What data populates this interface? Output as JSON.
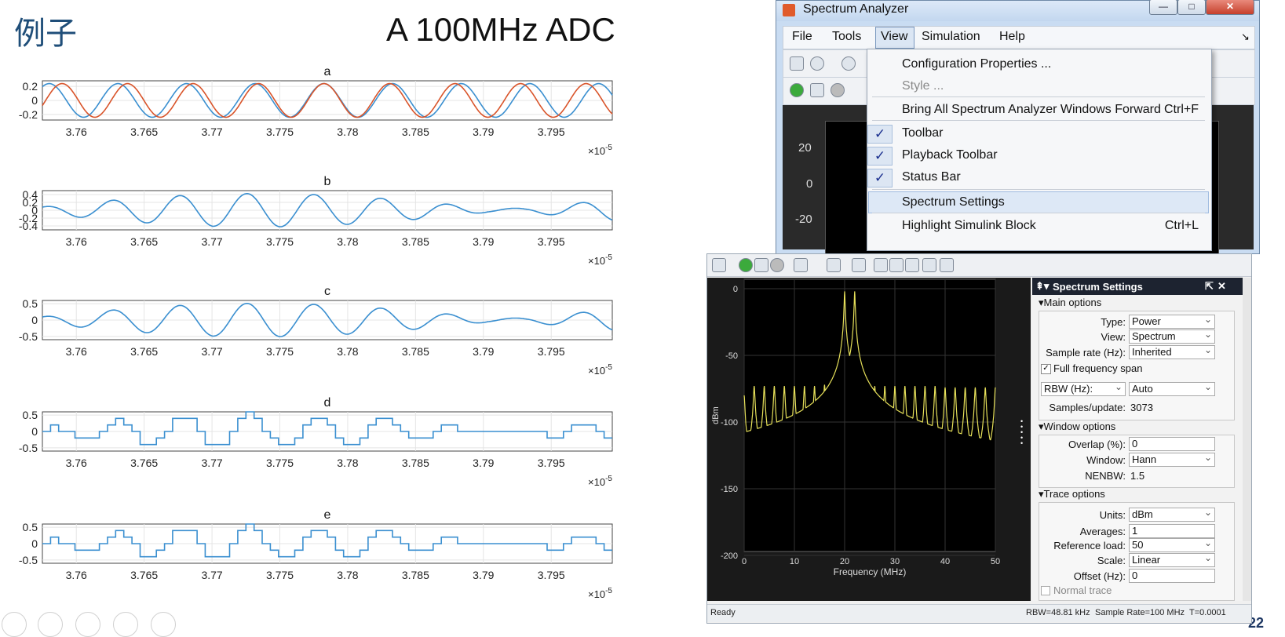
{
  "slide": {
    "title": "例子",
    "heading": "A 100MHz ADC",
    "page_number": "22"
  },
  "plots": [
    {
      "title": "a",
      "yticks": [
        "0.2",
        "0",
        "-0.2"
      ],
      "ylim": [
        -0.28,
        0.28
      ],
      "series_colors": [
        "#3a8fd0",
        "#d9542a"
      ],
      "kind": "two-sines"
    },
    {
      "title": "b",
      "yticks": [
        "0.4",
        "0.2",
        "0",
        "-0.2",
        "-0.4"
      ],
      "ylim": [
        -0.5,
        0.5
      ],
      "series_colors": [
        "#3a8fd0"
      ],
      "kind": "beat"
    },
    {
      "title": "c",
      "yticks": [
        "0.5",
        "0",
        "-0.5"
      ],
      "ylim": [
        -0.6,
        0.6
      ],
      "series_colors": [
        "#3a8fd0"
      ],
      "kind": "beat"
    },
    {
      "title": "d",
      "yticks": [
        "0.5",
        "0",
        "-0.5"
      ],
      "ylim": [
        -0.6,
        0.6
      ],
      "series_colors": [
        "#3a8fd0"
      ],
      "kind": "stairs"
    },
    {
      "title": "e",
      "yticks": [
        "0.5",
        "0",
        "-0.5"
      ],
      "ylim": [
        -0.6,
        0.6
      ],
      "series_colors": [
        "#3a8fd0"
      ],
      "kind": "stairs"
    }
  ],
  "plot_xticks": [
    "3.76",
    "3.765",
    "3.77",
    "3.775",
    "3.78",
    "3.785",
    "3.79",
    "3.795"
  ],
  "plot_xrange": [
    3.7575,
    3.7995
  ],
  "plot_xexp": "×10",
  "plot_xexp_pow": "-5",
  "sa": {
    "title": "Spectrum Analyzer",
    "menu": [
      "File",
      "Tools",
      "View",
      "Simulation",
      "Help"
    ],
    "yticks": [
      "20",
      "0",
      "-20"
    ],
    "view_menu": [
      {
        "label": "Configuration Properties ...",
        "shortcut": "",
        "checked": false,
        "disabled": false
      },
      {
        "label": "Style ...",
        "shortcut": "",
        "checked": false,
        "disabled": true
      },
      {
        "label": "Bring All Spectrum Analyzer Windows Forward",
        "shortcut": "Ctrl+F",
        "checked": false,
        "disabled": false
      },
      {
        "label": "Toolbar",
        "shortcut": "",
        "checked": true,
        "disabled": false
      },
      {
        "label": "Playback Toolbar",
        "shortcut": "",
        "checked": true,
        "disabled": false
      },
      {
        "label": "Status Bar",
        "shortcut": "",
        "checked": true,
        "disabled": false
      },
      {
        "label": "Spectrum Settings",
        "shortcut": "",
        "checked": false,
        "disabled": false
      },
      {
        "label": "Highlight Simulink Block",
        "shortcut": "Ctrl+L",
        "checked": false,
        "disabled": false
      }
    ]
  },
  "spectrum": {
    "ylabel": "dBm",
    "xlabel": "Frequency (MHz)",
    "yticks": [
      "0",
      "-50",
      "-100",
      "-150",
      "-200"
    ],
    "xticks": [
      "0",
      "10",
      "20",
      "30",
      "40",
      "50"
    ],
    "trace_color": "#e6e05a",
    "peaks_mhz": [
      0,
      2,
      4,
      6,
      8,
      10,
      12,
      14,
      16,
      18,
      20,
      21,
      22,
      24,
      26,
      28,
      30,
      32,
      34,
      36,
      38,
      40,
      42,
      44,
      46,
      48,
      50
    ],
    "peak_db": [
      -80,
      -73,
      -73,
      -73,
      -73,
      -73,
      -73,
      -73,
      -72,
      -70,
      -2,
      -55,
      -2,
      -72,
      -73,
      -73,
      -73,
      -73,
      -73,
      -73,
      -73,
      -74,
      -74,
      -74,
      -74,
      -74,
      -74
    ],
    "floor_db": -150
  },
  "panel": {
    "title": "Spectrum Settings",
    "main": "Main options",
    "type_label": "Type:",
    "type_value": "Power",
    "view_label": "View:",
    "view_value": "Spectrum",
    "rate_label": "Sample rate (Hz):",
    "rate_value": "Inherited",
    "full_span": "Full frequency span",
    "rbw_label": "RBW (Hz):",
    "rbw_value": "Auto",
    "samples_label": "Samples/update:",
    "samples_value": "3073",
    "window": "Window options",
    "overlap_label": "Overlap (%):",
    "overlap_value": "0",
    "window_label": "Window:",
    "window_value": "Hann",
    "nenbw_label": "NENBW:",
    "nenbw_value": "1.5",
    "trace": "Trace options",
    "units_label": "Units:",
    "units_value": "dBm",
    "avg_label": "Averages:",
    "avg_value": "1",
    "ref_label": "Reference load:",
    "ref_value": "50",
    "scale_label": "Scale:",
    "scale_value": "Linear",
    "offset_label": "Offset (Hz):",
    "offset_value": "0",
    "normal_trace": "Normal trace"
  },
  "status": {
    "ready": "Ready",
    "rbw": "RBW=48.81 kHz",
    "rate": "Sample Rate=100 MHz",
    "t": "T=0.0001"
  }
}
